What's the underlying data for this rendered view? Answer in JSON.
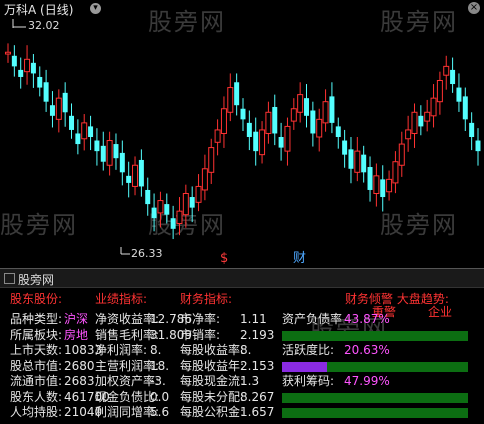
{
  "chart": {
    "title": "万科A (日线)",
    "high_label": "32.02",
    "low_label": "26.33",
    "marker_s": "$",
    "marker_cai": "财"
  },
  "watermark": "股旁网",
  "info": {
    "title": "股旁网",
    "headers": {
      "col1": "股东股份:",
      "col2": "业绩指标:",
      "col3": "财务指标:",
      "col4": "财务倾警 大盘趋势:",
      "warn": "重警",
      "trend": "企业"
    },
    "rows": [
      {
        "l1": "品种类型:",
        "v1": "沪深",
        "l2": "净资收益率:",
        "v2": "12.786",
        "l3": "市净率:",
        "v3": "1.11",
        "l4": "资产负债率",
        "v4": "43.87%",
        "bar": 0.44
      },
      {
        "l1": "所属板块:",
        "v1": "房地",
        "l2": "销售毛利率:",
        "v2": "31.809",
        "l3": "市销率:",
        "v3": "2.193",
        "l4": "",
        "v4": "",
        "bar": 0.0
      },
      {
        "l1": "上市天数:",
        "v1": "10833",
        "l2": "净利润率:",
        "v2": "8.",
        "l3": "每股收益率:",
        "v3": "8.",
        "l4": "活跃度比:",
        "v4": "20.63%",
        "bar": 0.21
      },
      {
        "l1": "股总市值:",
        "v1": "2680",
        "l2": "主营利润率:",
        "v2": "18.",
        "l3": "每股收益年:",
        "v3": "2.153",
        "l4": "",
        "v4": "",
        "bar": 0.24
      },
      {
        "l1": "流通市值:",
        "v1": "2683",
        "l2": "加权资产率:",
        "v2": "-3.",
        "l3": "每股现金流:",
        "v3": "1.3",
        "l4": "获利筹码:",
        "v4": "47.99%",
        "bar": 0.48
      },
      {
        "l1": "股东人数:",
        "v1": "461700",
        "l2": "现金负债比:",
        "v2": "0.0",
        "l3": "每股未分配:",
        "v3": "8.267",
        "l4": "",
        "v4": "",
        "bar": 0.0
      },
      {
        "l1": "人均持股:",
        "v1": "21040",
        "l2": "利润同增率:",
        "v2": "5.6",
        "l3": "每股公积金:",
        "v3": "1.657",
        "l4": "",
        "v4": "",
        "bar": 0.0
      }
    ]
  },
  "colors": {
    "up": "#ff3232",
    "down": "#54ffff",
    "bar_bg": "#0c6e12",
    "bar_fg": "#8a2be2"
  }
}
